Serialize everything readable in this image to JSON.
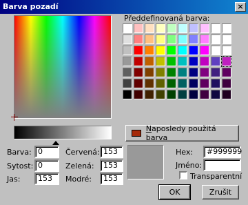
{
  "window": {
    "title": "Barva pozadí",
    "close_glyph": "×"
  },
  "predefined": {
    "label": "Předdefinovaná barva:",
    "swatches": [
      [
        "#ffffff",
        "#ffc0c0",
        "#ffe0c0",
        "#ffffc0",
        "#c0ffc0",
        "#c0ffff",
        "#c0c0ff",
        "#ffc0ff",
        "#ffffff",
        "#ffffff"
      ],
      [
        "#e0e0e0",
        "#ff8080",
        "#ffc080",
        "#ffff80",
        "#80ff80",
        "#80ffff",
        "#8080ff",
        "#ff80ff",
        "#ffffff",
        "#ffffff"
      ],
      [
        "#c0c0c0",
        "#ff0000",
        "#ff8000",
        "#ffff00",
        "#00ff00",
        "#00ffff",
        "#0000ff",
        "#ff00ff",
        "#ffffff",
        "#ffffff"
      ],
      [
        "#999999",
        "#c00000",
        "#c06000",
        "#c0c000",
        "#00c000",
        "#00c0c0",
        "#0000c0",
        "#c000c0",
        "#6040c0",
        "#c020c0"
      ],
      [
        "#606060",
        "#800000",
        "#804000",
        "#808000",
        "#008000",
        "#008080",
        "#000080",
        "#800080",
        "#402080",
        "#600060"
      ],
      [
        "#404040",
        "#600000",
        "#603000",
        "#606000",
        "#006000",
        "#006060",
        "#000060",
        "#600060",
        "#201060",
        "#400040"
      ],
      [
        "#000000",
        "#400000",
        "#402000",
        "#404000",
        "#004000",
        "#004040",
        "#000040",
        "#400040",
        "#100840",
        "#200020"
      ]
    ],
    "selected_swatch": "#999999"
  },
  "recent": {
    "label_mnemonic": "N",
    "label_rest": "aposledy použitá barva",
    "chip_color": "#a52a0a"
  },
  "hsl": {
    "hue_label": "Barva:",
    "hue_value": "0",
    "sat_label": "Sytost:",
    "sat_value": "0",
    "lum_label": "Jas:",
    "lum_value": "153"
  },
  "rgb": {
    "red_label": "Červená:",
    "red_value": "153",
    "green_label": "Zelená:",
    "green_value": "153",
    "blue_label": "Modré:",
    "blue_value": "153"
  },
  "hex": {
    "label": "Hex:",
    "value": "#999999"
  },
  "name": {
    "label": "Jméno:",
    "value": ""
  },
  "transparent": {
    "label": "Transparentní",
    "checked": false
  },
  "preview_color": "#999999",
  "buttons": {
    "ok": "OK",
    "cancel": "Zrušit"
  }
}
